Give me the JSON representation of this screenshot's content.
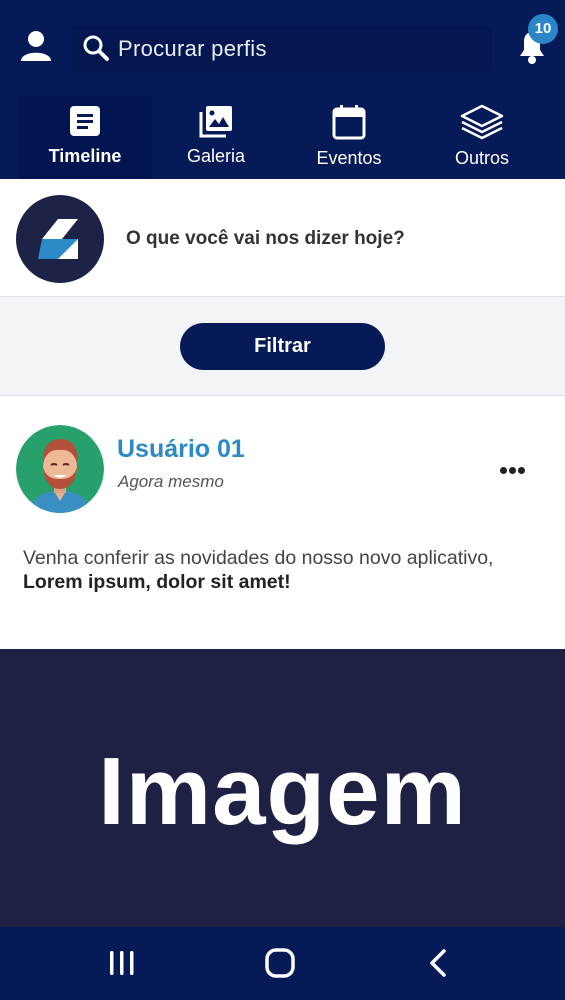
{
  "header": {
    "search": {
      "placeholder": "Procurar perfis"
    },
    "notifications": {
      "count": "10"
    },
    "tabs": [
      {
        "label": "Timeline",
        "icon": "document-icon",
        "active": true
      },
      {
        "label": "Galeria",
        "icon": "gallery-icon",
        "active": false
      },
      {
        "label": "Eventos",
        "icon": "calendar-icon",
        "active": false
      },
      {
        "label": "Outros",
        "icon": "layers-icon",
        "active": false
      }
    ]
  },
  "composer": {
    "prompt": "O que você vai nos dizer hoje?"
  },
  "filter": {
    "label": "Filtrar"
  },
  "post": {
    "author": "Usuário 01",
    "time": "Agora mesmo",
    "text": "Venha conferir as novidades do nosso novo aplicativo,",
    "text_bold": "Lorem ipsum, dolor sit amet!",
    "image_label": "Imagem"
  },
  "colors": {
    "primary": "#051a57",
    "accent": "#2c8ac6",
    "image_bg": "#1e2044"
  }
}
